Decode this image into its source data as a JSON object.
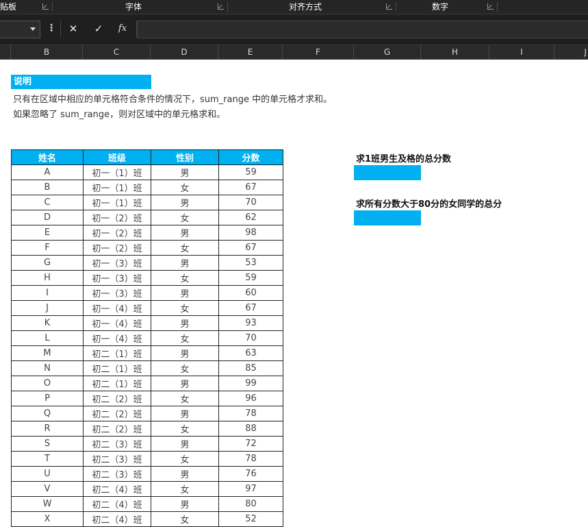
{
  "ribbon": {
    "groups": [
      "贴板",
      "字体",
      "对齐方式",
      "数字"
    ]
  },
  "formula_bar": {
    "cancel_icon": "✕",
    "enter_icon": "✓",
    "fx_label": "fx",
    "formula": ""
  },
  "columns": [
    "B",
    "C",
    "D",
    "E",
    "F",
    "G",
    "H",
    "I",
    "J"
  ],
  "note": {
    "title": "说明",
    "line1": "只有在区域中相应的单元格符合条件的情况下，sum_range 中的单元格才求和。",
    "line2": "如果忽略了 sum_range，则对区域中的单元格求和。"
  },
  "table": {
    "headers": [
      "姓名",
      "班级",
      "性别",
      "分数"
    ],
    "rows": [
      [
        "A",
        "初一（1）班",
        "男",
        "59"
      ],
      [
        "B",
        "初一（1）班",
        "女",
        "67"
      ],
      [
        "C",
        "初一（1）班",
        "男",
        "70"
      ],
      [
        "D",
        "初一（2）班",
        "女",
        "62"
      ],
      [
        "E",
        "初一（2）班",
        "男",
        "98"
      ],
      [
        "F",
        "初一（2）班",
        "女",
        "67"
      ],
      [
        "G",
        "初一（3）班",
        "男",
        "53"
      ],
      [
        "H",
        "初一（3）班",
        "女",
        "59"
      ],
      [
        "I",
        "初一（3）班",
        "男",
        "60"
      ],
      [
        "J",
        "初一（4）班",
        "女",
        "67"
      ],
      [
        "K",
        "初一（4）班",
        "男",
        "93"
      ],
      [
        "L",
        "初一（4）班",
        "女",
        "70"
      ],
      [
        "M",
        "初二（1）班",
        "男",
        "63"
      ],
      [
        "N",
        "初二（1）班",
        "女",
        "85"
      ],
      [
        "O",
        "初二（1）班",
        "男",
        "99"
      ],
      [
        "P",
        "初二（2）班",
        "女",
        "96"
      ],
      [
        "Q",
        "初二（2）班",
        "男",
        "78"
      ],
      [
        "R",
        "初二（2）班",
        "女",
        "88"
      ],
      [
        "S",
        "初二（3）班",
        "男",
        "72"
      ],
      [
        "T",
        "初二（3）班",
        "女",
        "78"
      ],
      [
        "U",
        "初二（3）班",
        "男",
        "76"
      ],
      [
        "V",
        "初二（4）班",
        "女",
        "97"
      ],
      [
        "W",
        "初二（4）班",
        "男",
        "80"
      ],
      [
        "X",
        "初二（4）班",
        "女",
        "52"
      ]
    ]
  },
  "tasks": [
    {
      "label": "求1班男生及格的总分数",
      "answer": ""
    },
    {
      "label": "求所有分数大于80分的女同学的总分",
      "answer": ""
    }
  ],
  "colors": {
    "accent": "#00b0f0",
    "dark_chrome": "#1f1f1f"
  }
}
